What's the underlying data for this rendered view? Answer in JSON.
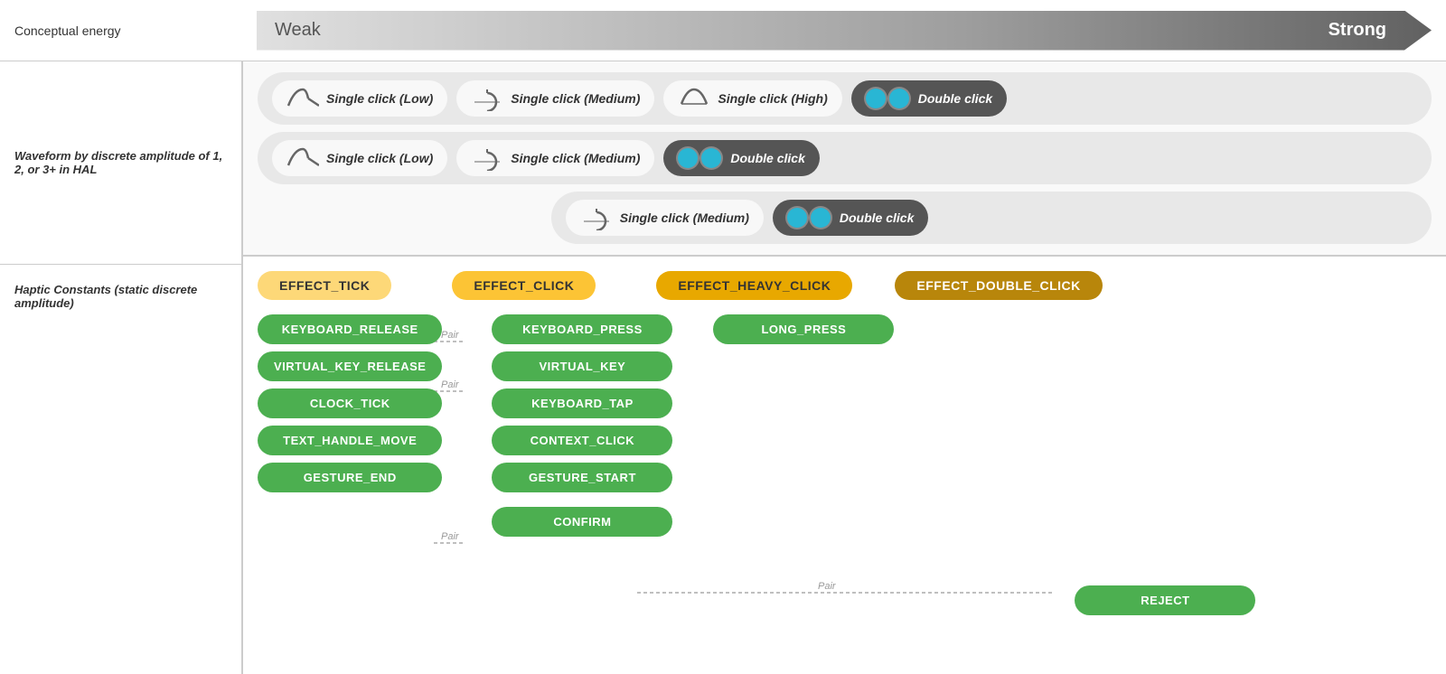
{
  "header": {
    "left_label": "Conceptual energy",
    "energy_weak": "Weak",
    "energy_strong": "Strong"
  },
  "waveform_section": {
    "label": "Waveform by discrete amplitude of 1, 2, or 3+ in HAL",
    "rows": [
      {
        "pills": [
          {
            "type": "wave-low",
            "label": "Single click (Low)"
          },
          {
            "type": "wave-med",
            "label": "Single click (Medium)"
          },
          {
            "type": "wave-high",
            "label": "Single click (High)"
          },
          {
            "type": "double",
            "label": "Double click",
            "dark": true
          }
        ]
      },
      {
        "pills": [
          {
            "type": "wave-low",
            "label": "Single click (Low)"
          },
          {
            "type": "wave-med",
            "label": "Single click (Medium)"
          },
          {
            "type": "double",
            "label": "Double click",
            "dark": true
          }
        ]
      },
      {
        "indented": true,
        "pills": [
          {
            "type": "wave-med",
            "label": "Single click (Medium)"
          },
          {
            "type": "double",
            "label": "Double click",
            "dark": true
          }
        ]
      }
    ]
  },
  "haptic_section": {
    "label": "Haptic Constants (static discrete amplitude)",
    "effects": [
      {
        "label": "EFFECT_TICK",
        "style": "tick"
      },
      {
        "label": "EFFECT_CLICK",
        "style": "click"
      },
      {
        "label": "EFFECT_HEAVY_CLICK",
        "style": "heavy"
      },
      {
        "label": "EFFECT_DOUBLE_CLICK",
        "style": "double"
      }
    ],
    "constants": {
      "tick_col": [
        "KEYBOARD_RELEASE",
        "VIRTUAL_KEY_RELEASE",
        "CLOCK_TICK",
        "TEXT_HANDLE_MOVE",
        "GESTURE_END"
      ],
      "click_col": [
        "KEYBOARD_PRESS",
        "VIRTUAL_KEY",
        "KEYBOARD_TAP",
        "CONTEXT_CLICK",
        "GESTURE_START",
        "CONFIRM"
      ],
      "heavy_col": [
        "LONG_PRESS"
      ],
      "double_col": [
        "REJECT"
      ]
    },
    "pairs": [
      {
        "label": "Pair",
        "from": "KEYBOARD_RELEASE",
        "to": "KEYBOARD_PRESS"
      },
      {
        "label": "Pair",
        "from": "VIRTUAL_KEY_RELEASE",
        "to": "VIRTUAL_KEY"
      },
      {
        "label": "Pair",
        "from": "GESTURE_END",
        "to": "GESTURE_START"
      },
      {
        "label": "Pair",
        "from": "CONFIRM",
        "to": "REJECT"
      }
    ]
  }
}
